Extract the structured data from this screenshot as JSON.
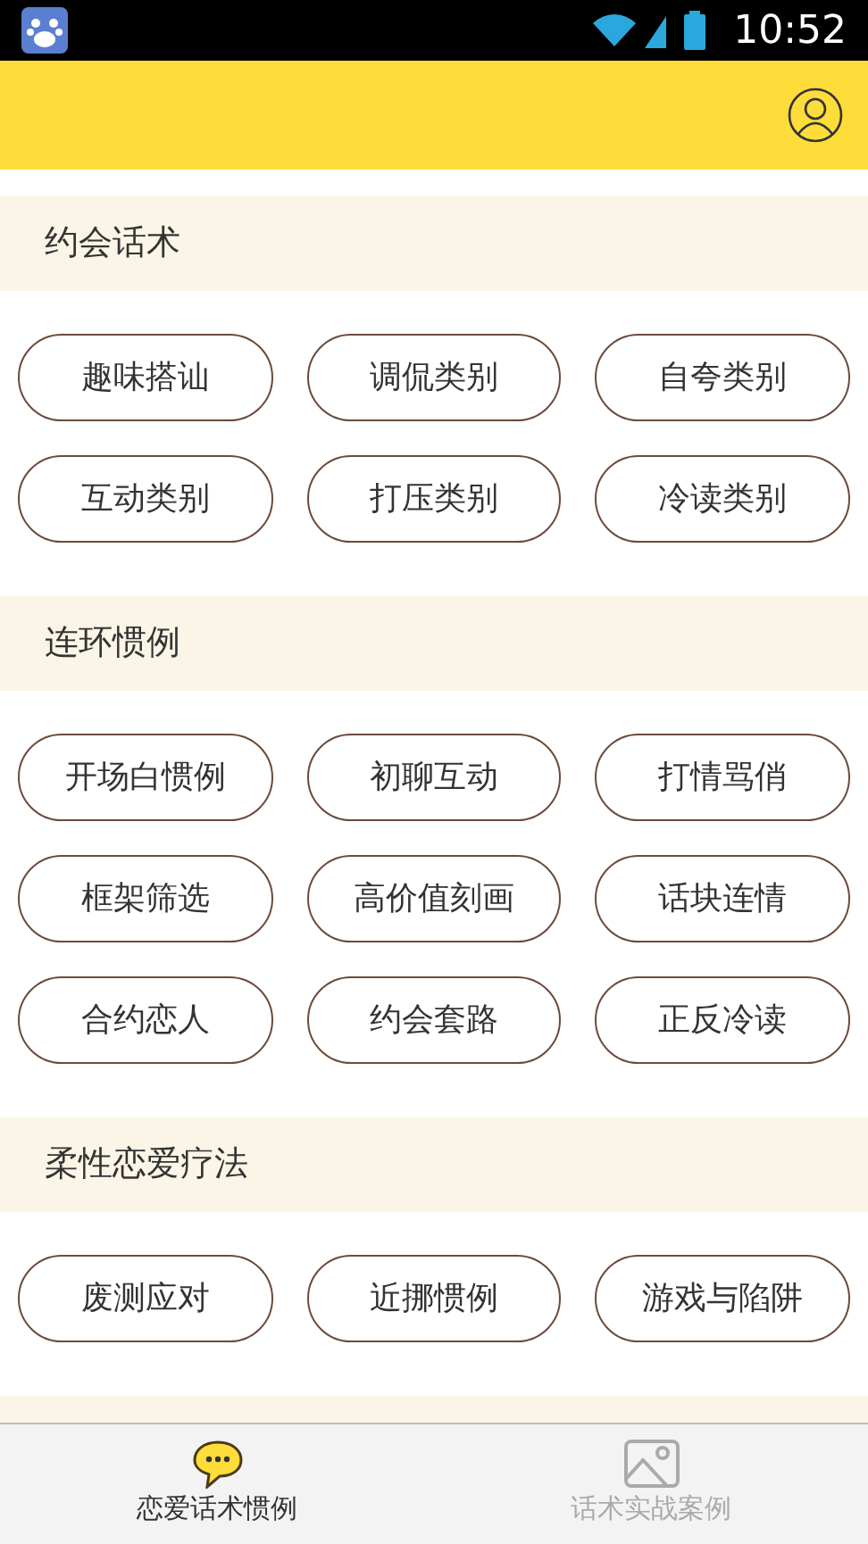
{
  "status_bar": {
    "time": "10:52"
  },
  "sections": [
    {
      "title": "约会话术",
      "buttons": [
        "趣味搭讪",
        "调侃类别",
        "自夸类别",
        "互动类别",
        "打压类别",
        "冷读类别"
      ]
    },
    {
      "title": "连环惯例",
      "buttons": [
        "开场白惯例",
        "初聊互动",
        "打情骂俏",
        "框架筛选",
        "高价值刻画",
        "话块连情",
        "合约恋人",
        "约会套路",
        "正反冷读"
      ]
    },
    {
      "title": "柔性恋爱疗法",
      "buttons": [
        "废测应对",
        "近挪惯例",
        "游戏与陷阱"
      ]
    }
  ],
  "tabs": [
    {
      "label": "恋爱话术惯例",
      "selected": true
    },
    {
      "label": "话术实战案例",
      "selected": false
    }
  ]
}
